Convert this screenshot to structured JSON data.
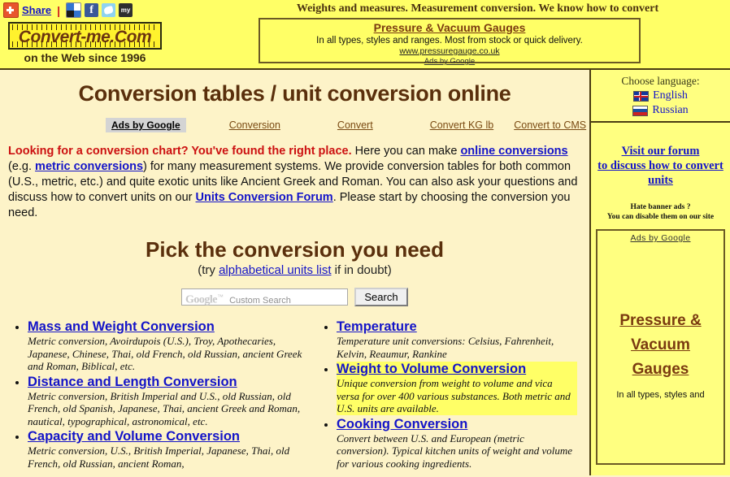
{
  "header": {
    "share": {
      "plus_icon": "addthis-plus-icon",
      "label": "Share",
      "divider": "|",
      "buttons": [
        {
          "name": "delicious",
          "label": ""
        },
        {
          "name": "facebook",
          "label": "f"
        },
        {
          "name": "twitter",
          "label": ""
        },
        {
          "name": "myspace",
          "label": "my"
        }
      ]
    },
    "logo": {
      "text": "Convert-me.Com",
      "subtitle": "on the Web since 1996"
    },
    "tagline": "Weights and measures. Measurement conversion. We know how to convert",
    "ad": {
      "title": "Pressure & Vacuum Gauges",
      "description": "In all types, styles and ranges. Most from stock or quick delivery.",
      "url": "www.pressuregauge.co.uk",
      "ads_by": "Ads by Google"
    }
  },
  "main": {
    "page_title": "Conversion tables / unit conversion online",
    "nav": {
      "ads_by_google": "Ads by Google",
      "links": [
        "Conversion",
        "Convert",
        "Convert KG lb",
        "Convert to CMS"
      ]
    },
    "intro": {
      "highlight": "Looking for a conversion chart? You've found the right place.",
      "t1": " Here you can make ",
      "link1": "online conversions",
      "t2": " (e.g. ",
      "link2": "metric conversions",
      "t3": ") for many measurement systems. We provide conversion tables for both common (U.S., metric, etc.) and quite exotic units like Ancient Greek and Roman. You can also ask your questions and discuss how to convert units on our ",
      "link3": "Units Conversion Forum",
      "t4": ". Please start by choosing the conversion you need."
    },
    "pick": {
      "title": "Pick the conversion you need",
      "sub_pre": "(try ",
      "sub_link": "alphabetical units list",
      "sub_post": " if in doubt)"
    },
    "search": {
      "google_word": "Google",
      "tm": "™",
      "placeholder": "Custom Search",
      "value": "",
      "button_label": "Search"
    },
    "left_column": [
      {
        "title": "Mass and Weight Conversion",
        "desc": "Metric conversion, Avoirdupois (U.S.), Troy, Apothecaries, Japanese, Chinese, Thai, old French, old Russian, ancient Greek and Roman, Biblical, etc.",
        "highlighted": false
      },
      {
        "title": "Distance and Length Conversion",
        "desc": "Metric conversion, British Imperial and U.S., old Russian, old French, old Spanish, Japanese, Thai, ancient Greek and Roman, nautical, typographical, astronomical, etc.",
        "highlighted": false
      },
      {
        "title": "Capacity and Volume Conversion",
        "desc": "Metric conversion, U.S., British Imperial, Japanese, Thai, old French, old Russian, ancient Roman,",
        "highlighted": false
      }
    ],
    "right_column": [
      {
        "title": "Temperature",
        "desc": "Temperature unit conversions: Celsius, Fahrenheit, Kelvin, Reaumur, Rankine",
        "highlighted": false
      },
      {
        "title": "Weight to Volume Conversion",
        "desc": "Unique conversion from weight to volume and vica versa for over 400 various substances. Both metric and U.S. units are available.",
        "highlighted": true
      },
      {
        "title": "Cooking Conversion",
        "desc": "Convert between U.S. and European (metric conversion). Typical kitchen units of weight and volume for various cooking ingredients.",
        "highlighted": false
      }
    ]
  },
  "sidebar": {
    "choose_language": "Choose language:",
    "languages": [
      {
        "flag": "uk-flag-icon",
        "label": "English"
      },
      {
        "flag": "russia-flag-icon",
        "label": "Russian"
      }
    ],
    "forum_line1": "Visit our forum",
    "forum_line2": "to discuss how to convert",
    "forum_line3": "units",
    "hate_ads_line1": "Hate banner ads ?",
    "hate_ads_line2": "You can disable them on our site",
    "ad": {
      "ads_by": "Ads by Google",
      "title_line1": "Pressure &",
      "title_line2": "Vacuum",
      "title_line3": "Gauges",
      "description": "In all types, styles and"
    }
  },
  "colors": {
    "header_bg": "#FFFF66",
    "main_bg": "#FDF3C8",
    "sidebar_bg": "#FFFF80",
    "heading_brown": "#5A2F0C",
    "link_blue": "#1414C8",
    "nav_link_brown": "#7A4A12",
    "alert_red": "#CC1111",
    "highlight_yellow": "#FFFF66",
    "border_dark": "#4A3C12"
  }
}
